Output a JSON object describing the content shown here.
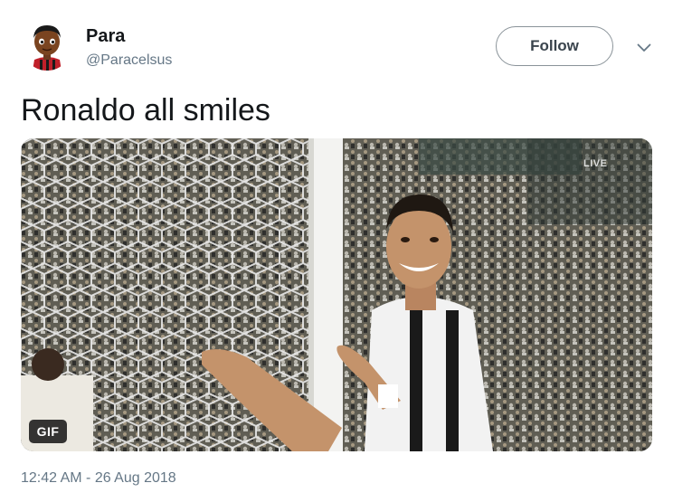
{
  "user": {
    "display_name": "Para",
    "handle": "@Paracelsus"
  },
  "actions": {
    "follow_label": "Follow"
  },
  "tweet": {
    "text": "Ronaldo all smiles",
    "media_badge": "GIF",
    "media_overlay": "LIVE",
    "timestamp": "12:42 AM - 26 Aug 2018"
  },
  "icons": {
    "avatar": "cartoon-avatar-icon",
    "caret": "chevron-down-icon"
  },
  "colors": {
    "text_primary": "#14171a",
    "text_secondary": "#657786",
    "follow_border": "#8a9399"
  }
}
